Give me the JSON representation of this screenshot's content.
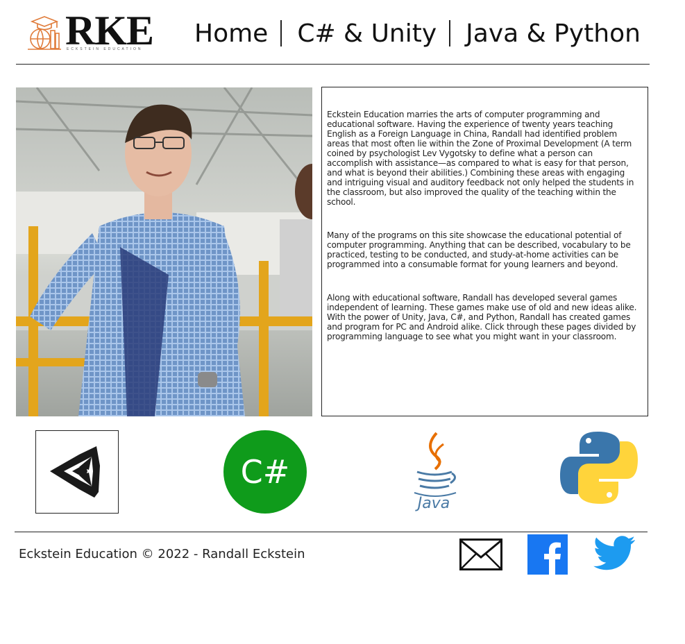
{
  "header": {
    "logo_text": "RKE",
    "logo_tagline": "ECKSTEIN EDUCATION",
    "nav": [
      {
        "label": "Home"
      },
      {
        "label": "C# & Unity"
      },
      {
        "label": "Java & Python"
      }
    ]
  },
  "main": {
    "paragraphs": [
      "Eckstein Education marries the arts of computer programming and educational software. Having the experience of twenty years teaching English as a Foreign Language in China, Randall had identified problem areas that most often lie within the Zone of Proximal Development (A term coined by psychologist Lev Vygotsky to define what a person can accomplish with assistance—as compared to what is easy for that person, and what is beyond their abilities.) Combining these areas with engaging and intriguing visual and auditory feedback not only helped the students in the classroom, but also improved the quality of the teaching within the school.",
      "Many of the programs on this site showcase the educational potential of computer programming. Anything that can be described, vocabulary to be practiced, testing to be conducted, and study-at-home activities can be programmed into a consumable format for young learners and beyond.",
      "Along with educational software, Randall has developed several games independent of learning. These games make use of old and new ideas alike. With the power of Unity, Java, C#, and Python, Randall has created games and program for PC and Android alike. Click through these pages divided by programming language to see what you might want in your classroom."
    ]
  },
  "languages": {
    "csharp_label": "C#",
    "java_label": "Java",
    "csharp_color": "#0f9b1b",
    "python_blue": "#3a76ab",
    "python_yellow": "#ffd43b",
    "java_blue": "#4a7aa5",
    "java_orange": "#e76f00"
  },
  "footer": {
    "copyright": "Eckstein Education © 2022 - Randall Eckstein",
    "facebook_color": "#1877f2",
    "twitter_color": "#1d9bf0"
  },
  "icons": [
    "graduation-cap-icon",
    "unity-icon",
    "csharp-icon",
    "java-icon",
    "python-icon",
    "mail-icon",
    "facebook-icon",
    "twitter-icon"
  ]
}
